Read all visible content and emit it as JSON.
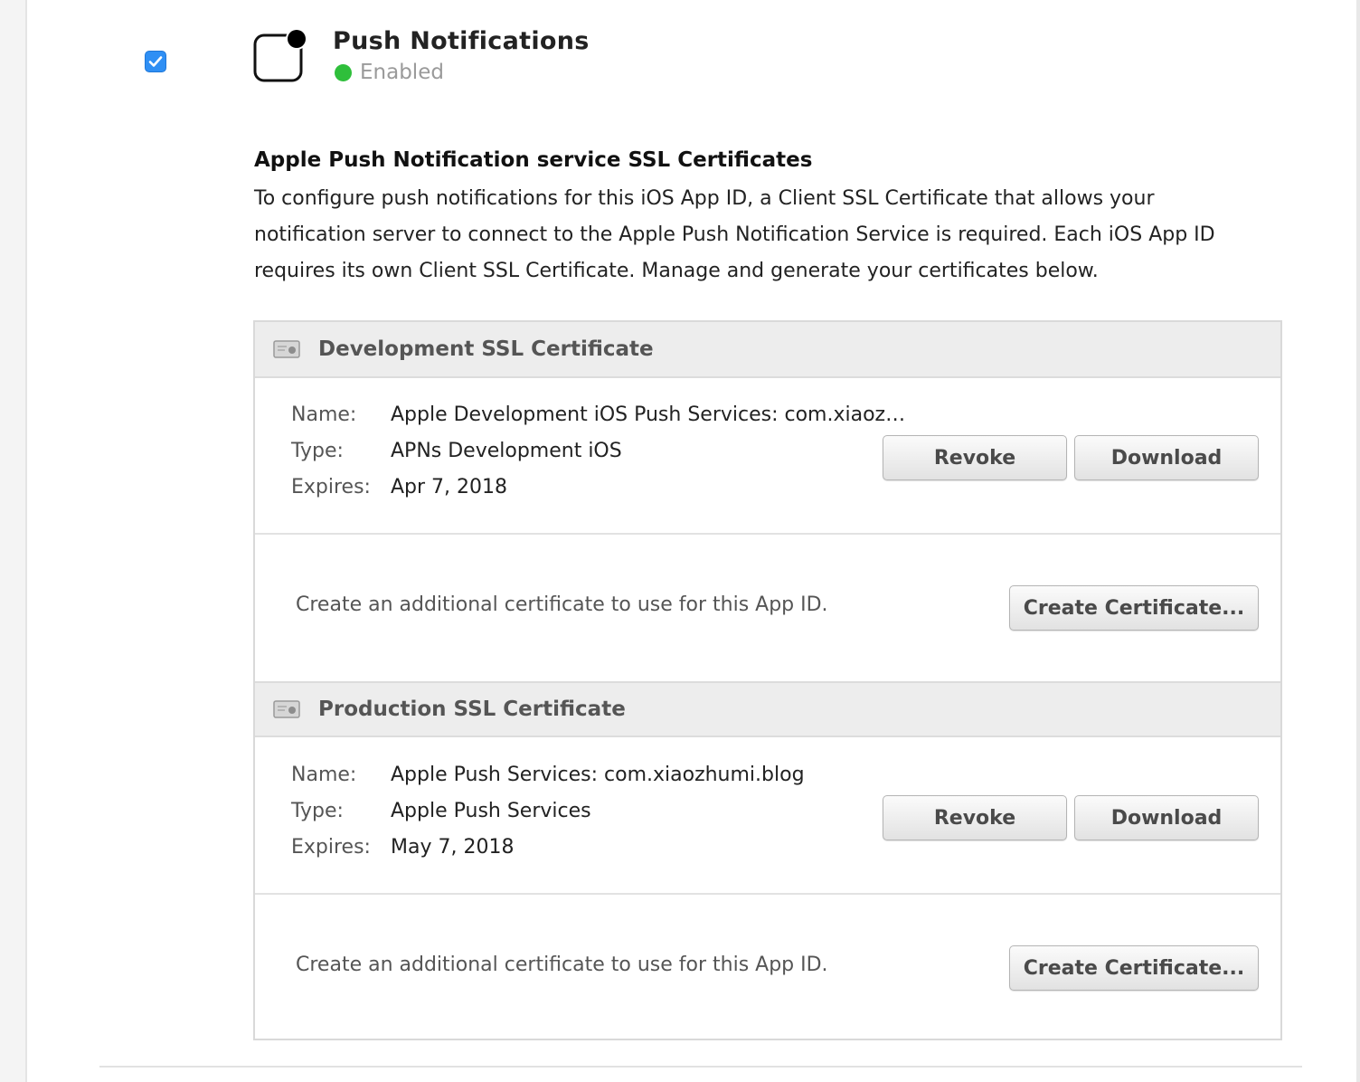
{
  "service": {
    "title": "Push Notifications",
    "status": "Enabled",
    "status_color": "#2fbf3b",
    "enabled": true,
    "icon": "push-notification-icon"
  },
  "section": {
    "heading": "Apple Push Notification service SSL Certificates",
    "description": "To configure push notifications for this iOS App ID, a Client SSL Certificate that allows your notification server to connect to the Apple Push Notification Service is required. Each iOS App ID requires its own Client SSL Certificate. Manage and generate your certificates below."
  },
  "labels": {
    "name": "Name:",
    "type": "Type:",
    "expires": "Expires:"
  },
  "development": {
    "title": "Development SSL Certificate",
    "icon": "certificate-icon",
    "name": "Apple Development iOS Push Services: com.xiaoz…",
    "type": "APNs Development iOS",
    "expires": "Apr 7, 2018",
    "revoke_label": "Revoke",
    "download_label": "Download",
    "create_text": "Create an additional certificate to use for this App ID.",
    "create_label": "Create Certificate..."
  },
  "production": {
    "title": "Production SSL Certificate",
    "icon": "certificate-icon",
    "name": "Apple Push Services: com.xiaozhumi.blog",
    "type": "Apple Push Services",
    "expires": "May 7, 2018",
    "revoke_label": "Revoke",
    "download_label": "Download",
    "create_text": "Create an additional certificate to use for this App ID.",
    "create_label": "Create Certificate..."
  }
}
